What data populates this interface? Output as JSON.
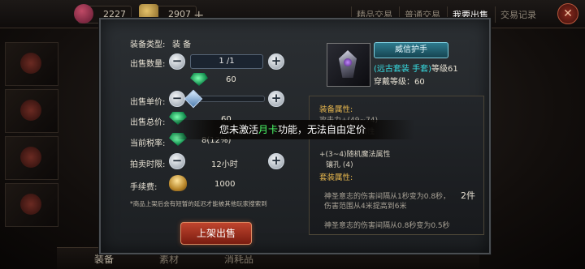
{
  "topbar": {
    "gem_count": "2227",
    "gold_count": "2907",
    "plus": "+",
    "tabs": [
      "精品交易",
      "普通交易",
      "我要出售",
      "交易记录"
    ],
    "close": "✕"
  },
  "bottom_tabs": [
    "装备",
    "素材",
    "消耗品"
  ],
  "sell_form": {
    "type_label": "装备类型:",
    "type_value": "装 备",
    "quantity_label": "出售数量:",
    "quantity_value": "1 /1",
    "quantity_price": "60",
    "unit_price_label": "出售单价:",
    "total_label": "出售总价:",
    "total_value": "60",
    "tax_label": "当前税率:",
    "tax_value": "8(12%)",
    "auction_label": "拍卖时限:",
    "auction_value": "12小时",
    "fee_label": "手续费:",
    "fee_value": "1000",
    "note": "*商品上架后会有短暂的延迟才能被其他玩家搜索到",
    "sell_button": "上架出售",
    "minus": "−",
    "plus": "+",
    "unit_price_slider_fraction": 0.04
  },
  "item": {
    "name": "威信护手",
    "set_prefix": "(远古套装 手套)",
    "level_text": "等级61",
    "wear_level": "穿戴等级：60",
    "attr_header": "装备属性:",
    "attr_1": "攻击力+(49~74)",
    "attr_2": "属性",
    "attr_3": "+(3~4)随机魔法属性",
    "attr_4": "镶孔 (4)",
    "set_header": "套装属性:",
    "set_1": "神圣意志的伤害间隔从1秒变为0.8秒，",
    "set_2": "伤害范围从4米提高到6米",
    "set_count": "2件",
    "set_3": "神圣意志的伤害间隔从0.8秒变为0.5秒"
  },
  "toast": {
    "before": "您未激活",
    "highlight": "月卡",
    "after": "功能，无法自由定价"
  },
  "colors": {
    "accent_green": "#4cff6a",
    "cyan": "#37e0e6",
    "gold_header": "#e8b84e",
    "sell_red": "#c0452e"
  }
}
